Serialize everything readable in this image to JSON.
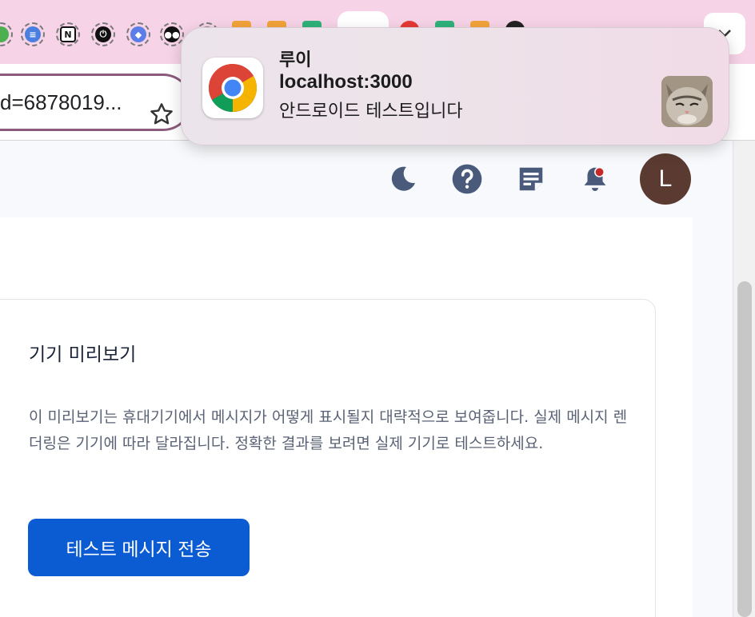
{
  "browser": {
    "url": "d=6878019...",
    "tabs": [
      {
        "icon": "green-site-icon",
        "color": "#4caf50"
      },
      {
        "icon": "docs-icon",
        "color": "#4a7ee0"
      },
      {
        "icon": "notion-icon",
        "color": "#111111"
      },
      {
        "icon": "power-icon",
        "color": "#111111"
      },
      {
        "icon": "shield-user-icon",
        "color": "#5b7de8"
      },
      {
        "icon": "medium-icon",
        "color": "#111111"
      }
    ]
  },
  "header": {
    "avatar_letter": "L",
    "icons": [
      "moon-icon",
      "help-icon",
      "notes-icon",
      "notification-bell-icon"
    ]
  },
  "card": {
    "title": "기기 미리보기",
    "description": "이 미리보기는 휴대기기에서 메시지가 어떻게 표시될지 대략적으로 보여줍니다. 실제 메시지 렌더링은 기기에 따라 달라집니다. 정확한 결과를 보려면 실제 기기로 테스트하세요.",
    "send_button": "테스트 메시지 전송"
  },
  "notification": {
    "app": "chrome-icon",
    "title": "루이",
    "source": "localhost:3000",
    "body": "안드로이드 테스트입니다"
  },
  "colors": {
    "tabstrip": "#f6d3e6",
    "primary_button": "#0b5bd3",
    "header_icon": "#4a5a7a",
    "avatar": "#5b3b31"
  }
}
